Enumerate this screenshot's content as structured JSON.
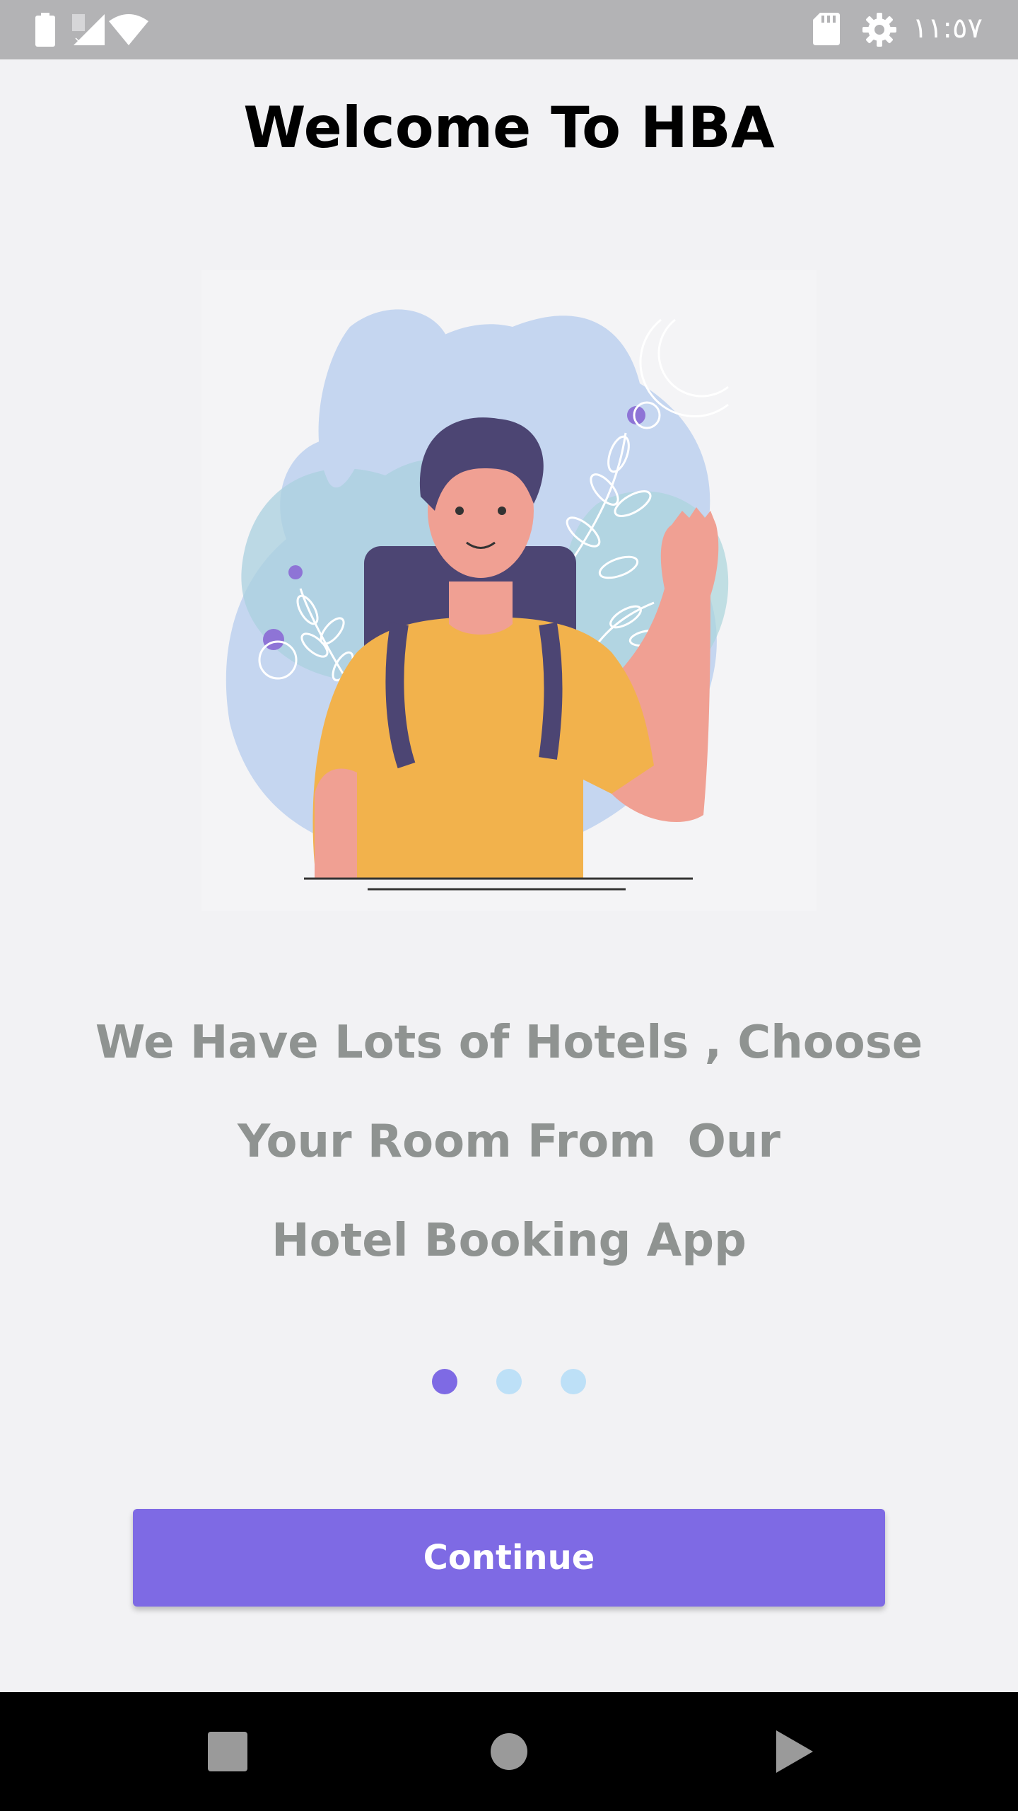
{
  "status_bar": {
    "time": "١١:٥٧",
    "icons": [
      "battery-icon",
      "no-signal-icon",
      "wifi-icon",
      "sd-card-icon",
      "settings-gear-icon"
    ],
    "icon_color": "#ffffff",
    "background": "#b3b3b5"
  },
  "header": {
    "title": "Welcome To HBA"
  },
  "illustration": {
    "subject": "waving-traveler-with-backpack"
  },
  "tagline": {
    "line1": "We Have Lots of Hotels , Choose",
    "line2": "Your Room From  Our",
    "line3": "Hotel Booking App"
  },
  "pager": {
    "total_pages": 3,
    "current_page": 1,
    "active_color": "#7e6ae4",
    "inactive_color": "#bde0f7"
  },
  "actions": {
    "continue_label": "Continue",
    "button_color": "#7e6ae4"
  },
  "nav_bar": {
    "buttons": [
      "recents-square-icon",
      "home-circle-icon",
      "back-triangle-icon"
    ],
    "icon_color": "#9a9a9a"
  }
}
